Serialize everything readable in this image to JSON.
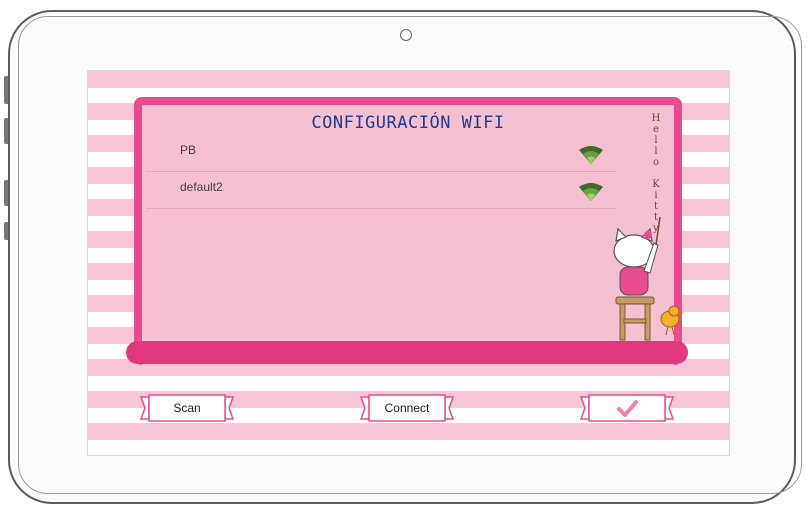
{
  "screen": {
    "title": "CONFIGURACIÓN WIFI",
    "networks": [
      {
        "name": "PB",
        "signal_icon": "wifi-signal-icon"
      },
      {
        "name": "default2",
        "signal_icon": "wifi-signal-icon"
      }
    ],
    "decoration_text": "Hello Kitty"
  },
  "buttons": {
    "scan_label": "Scan",
    "connect_label": "Connect",
    "confirm_icon": "checkmark-icon"
  },
  "colors": {
    "accent": "#e94b8f",
    "panel": "#f6c0d3",
    "title": "#1f3d8a",
    "wifi": "#5a8c3a"
  }
}
